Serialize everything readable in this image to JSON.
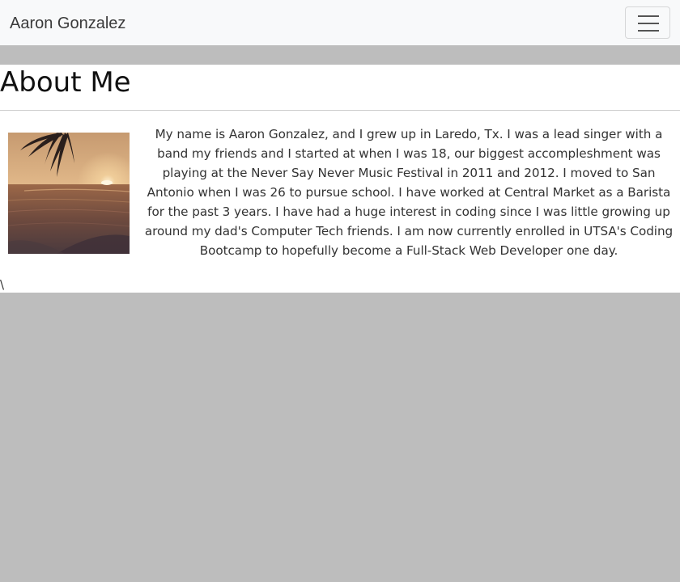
{
  "navbar": {
    "brand": "Aaron Gonzalez",
    "toggler_icon": "hamburger-menu-icon",
    "background": "#f8f9fa"
  },
  "page": {
    "title": "About Me",
    "photo_description_icon": "sunset-beach-photo",
    "bio": "My name is Aaron Gonzalez, and I grew up in Laredo, Tx. I was a lead singer with a band my friends and I started at when I was 18, our biggest accompleshment was playing at the Never Say Never Music Festival in 2011 and 2012. I moved to San Antonio when I was 26 to pursue school. I have worked at Central Market as a Barista for the past 3 years. I have had a huge interest in coding since I was little growing up around my dad's Computer Tech friends. I am now currently enrolled in UTSA's Coding Bootcamp to hopefully become a Full-Stack Web Developer one day.",
    "stray_text": "\\"
  },
  "colors": {
    "page_background": "#bdbdbd",
    "content_background": "#ffffff"
  }
}
